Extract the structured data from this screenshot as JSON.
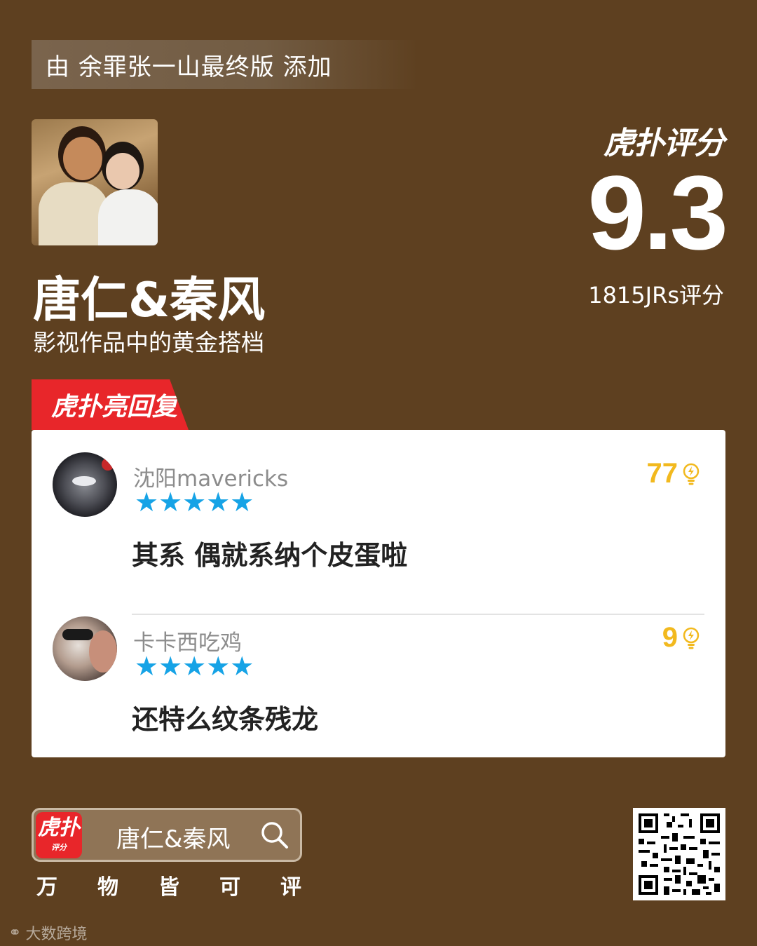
{
  "header": {
    "added_by_prefix": "由",
    "added_by_user": "余罪张一山最终版",
    "added_by_suffix": "添加"
  },
  "subject": {
    "title": "唐仁&秦风",
    "subtitle": "影视作品中的黄金搭档"
  },
  "rating": {
    "brand": "虎扑评分",
    "score": "9.3",
    "count_text": "1815JRs评分"
  },
  "replies_section": {
    "tag": "虎扑亮回复",
    "items": [
      {
        "username": "沈阳mavericks",
        "stars": "★★★★★",
        "likes": "77",
        "comment": "其系 偶就系纳个皮蛋啦"
      },
      {
        "username": "卡卡西吃鸡",
        "stars": "★★★★★",
        "likes": "9",
        "comment": "还特么纹条残龙"
      }
    ]
  },
  "footer": {
    "app_icon_big": "虎扑",
    "app_icon_small": "评分",
    "search_text": "唐仁&秦风",
    "slogan": [
      "万",
      "物",
      "皆",
      "可",
      "评"
    ],
    "watermark": "大数跨境"
  },
  "colors": {
    "background": "#5e4020",
    "accent_red": "#e8262a",
    "star_blue": "#16a3e6",
    "like_gold": "#f2b91e"
  }
}
